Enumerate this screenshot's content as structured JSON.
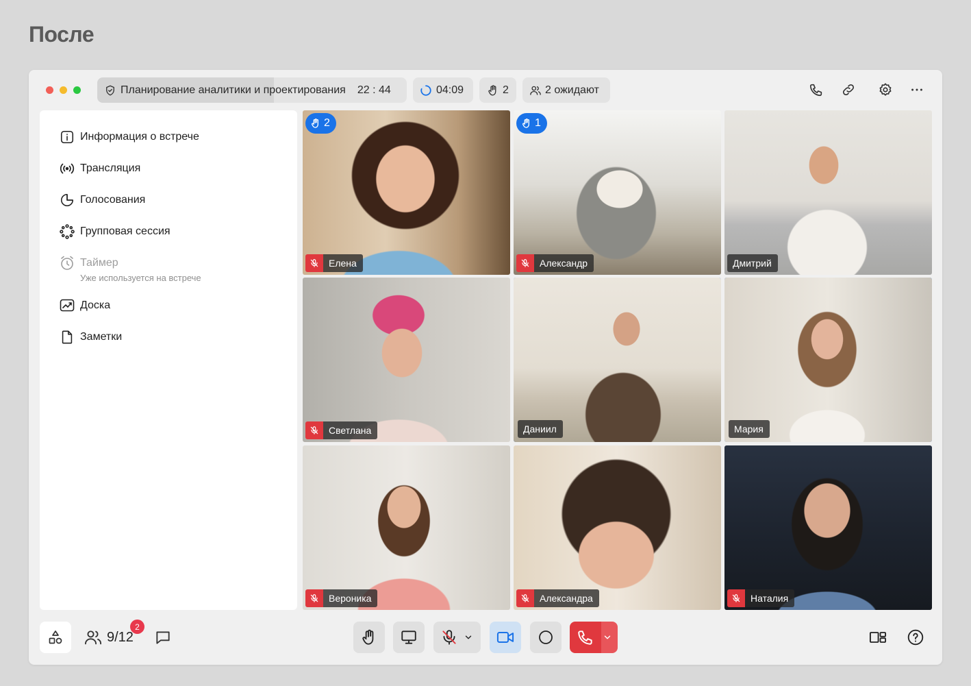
{
  "page": {
    "heading": "После"
  },
  "titlebar": {
    "meeting_title": "Планирование аналитики и проектирования",
    "meeting_clock": "22 : 44",
    "timer": "04:09",
    "raised_hands": "2",
    "waiting": "2 ожидают",
    "icons": [
      "phone-icon",
      "link-icon",
      "gear-icon",
      "more-icon"
    ]
  },
  "sidebar": {
    "items": [
      {
        "label": "Информация о встрече",
        "icon": "info-icon"
      },
      {
        "label": "Трансляция",
        "icon": "broadcast-icon"
      },
      {
        "label": "Голосования",
        "icon": "pie-chart-icon"
      },
      {
        "label": "Групповая сессия",
        "icon": "group-session-icon"
      },
      {
        "label": "Таймер",
        "sublabel": "Уже используется на встрече",
        "icon": "alarm-icon",
        "disabled": true
      },
      {
        "label": "Доска",
        "icon": "whiteboard-icon"
      },
      {
        "label": "Заметки",
        "icon": "notes-icon"
      }
    ]
  },
  "participants_grid": [
    {
      "name": "Елена",
      "muted": true,
      "raised_hand": "2",
      "active": false
    },
    {
      "name": "Александр",
      "muted": true,
      "raised_hand": "1",
      "active": false
    },
    {
      "name": "Дмитрий",
      "muted": false,
      "active": false
    },
    {
      "name": "Светлана",
      "muted": true,
      "active": false
    },
    {
      "name": "Даниил",
      "muted": false,
      "active": true
    },
    {
      "name": "Мария",
      "muted": false,
      "active": true
    },
    {
      "name": "Вероника",
      "muted": true,
      "active": false
    },
    {
      "name": "Александра",
      "muted": true,
      "active": false
    },
    {
      "name": "Наталия",
      "muted": true,
      "active": false
    }
  ],
  "bottombar": {
    "participants_count": "9/12",
    "participants_badge": "2",
    "controls": [
      "apps-icon",
      "people-icon",
      "chat-icon",
      "raise-hand-icon",
      "screen-share-icon",
      "mic-off-icon",
      "camera-icon",
      "record-icon",
      "hangup-icon",
      "layout-icon",
      "help-icon"
    ]
  },
  "colors": {
    "accent": "#1a73e8",
    "danger": "#e0383e",
    "badge": "#e8394d"
  }
}
